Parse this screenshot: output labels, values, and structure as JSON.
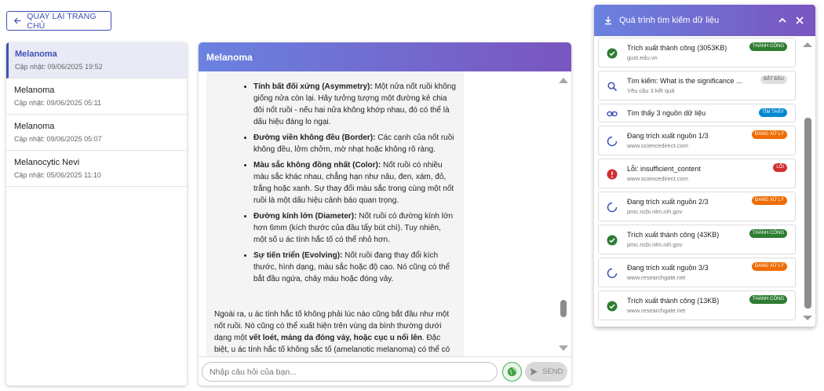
{
  "back_button": {
    "label": "QUAY LẠI TRANG CHỦ"
  },
  "sidebar": {
    "items": [
      {
        "title": "Melanoma",
        "subtitle": "Cập nhật: 09/06/2025 19:52",
        "active": true
      },
      {
        "title": "Melanoma",
        "subtitle": "Cập nhật: 09/06/2025 05:11",
        "active": false
      },
      {
        "title": "Melanoma",
        "subtitle": "Cập nhật: 09/06/2025 05:07",
        "active": false
      },
      {
        "title": "Melanocytic Nevi",
        "subtitle": "Cập nhật: 05/06/2025 11:10",
        "active": false
      }
    ]
  },
  "chat": {
    "title": "Melanoma",
    "bullets": [
      {
        "bold": "Tính bất đối xứng (Asymmetry):",
        "text": " Một nửa nốt ruồi không giống nửa còn lại. Hãy tưởng tượng một đường kẻ chia đôi nốt ruồi - nếu hai nửa không khớp nhau, đó có thể là dấu hiệu đáng lo ngại."
      },
      {
        "bold": "Đường viền không đều (Border):",
        "text": " Các cạnh của nốt ruồi không đều, lởm chởm, mờ nhạt hoặc không rõ ràng."
      },
      {
        "bold": "Màu sắc không đồng nhất (Color):",
        "text": " Nốt ruồi có nhiều màu sắc khác nhau, chẳng hạn như nâu, đen, xám, đỏ, trắng hoặc xanh. Sự thay đổi màu sắc trong cùng một nốt ruồi là một dấu hiệu cảnh báo quan trọng."
      },
      {
        "bold": "Đường kính lớn (Diameter):",
        "text": " Nốt ruồi có đường kính lớn hơn 6mm (kích thước của đầu tẩy bút chì). Tuy nhiên, một số u ác tính hắc tố có thể nhỏ hơn."
      },
      {
        "bold": "Sự tiến triển (Evolving):",
        "text": " Nốt ruồi đang thay đổi kích thước, hình dạng, màu sắc hoặc độ cao. Nó cũng có thể bắt đầu ngứa, chảy máu hoặc đóng vảy."
      }
    ],
    "paragraph": {
      "before": "Ngoài ra, u ác tính hắc tố không phải lúc nào cũng bắt đầu như một nốt ruồi. Nó cũng có thể xuất hiện trên vùng da bình thường dưới dạng một ",
      "bold": "vết loét, mảng da đóng vảy, hoặc cục u nổi lên",
      "after": ". Đặc biệt, u ác tính hắc tố không sắc tố (amelanotic melanoma) có thể có"
    },
    "input_placeholder": "Nhập câu hỏi của bạn...",
    "send_label": "SEND"
  },
  "panel": {
    "title": "Quá trình tìm kiếm dữ liệu",
    "steps": [
      {
        "icon": "check-circle-icon",
        "title": "Trích xuất thành công (3053KB)",
        "sub": "gust.edu.vn",
        "badge": "THÀNH CÔNG",
        "color": "#2e7d32"
      },
      {
        "icon": "search-icon",
        "title": "Tìm kiếm: What is the significance ...",
        "sub": "Yêu cầu 3 kết quả",
        "badge": "BẮT ĐẦU",
        "color": "#e0e0e0"
      },
      {
        "icon": "link-icon",
        "title": "Tìm thấy 3 nguồn dữ liệu",
        "sub": "",
        "badge": "TÌM THẤY",
        "color": "#0288d1"
      },
      {
        "icon": "spinner-icon",
        "title": "Đang trích xuất nguồn 1/3",
        "sub": "www.sciencedirect.com",
        "badge": "ĐANG XỬ LÝ",
        "color": "#ef6c00"
      },
      {
        "icon": "error-icon",
        "title": "Lỗi: insufficient_content",
        "sub": "www.sciencedirect.com",
        "badge": "LỖI",
        "color": "#d32f2f"
      },
      {
        "icon": "spinner-icon",
        "title": "Đang trích xuất nguồn 2/3",
        "sub": "pmc.ncbi.nlm.nih.gov",
        "badge": "ĐANG XỬ LÝ",
        "color": "#ef6c00"
      },
      {
        "icon": "check-circle-icon",
        "title": "Trích xuất thành công (43KB)",
        "sub": "pmc.ncbi.nlm.nih.gov",
        "badge": "THÀNH CÔNG",
        "color": "#2e7d32"
      },
      {
        "icon": "spinner-icon",
        "title": "Đang trích xuất nguồn 3/3",
        "sub": "www.researchgate.net",
        "badge": "ĐANG XỬ LÝ",
        "color": "#ef6c00"
      },
      {
        "icon": "check-circle-icon",
        "title": "Trích xuất thành công (13KB)",
        "sub": "www.researchgate.net",
        "badge": "THÀNH CÔNG",
        "color": "#2e7d32"
      }
    ]
  }
}
